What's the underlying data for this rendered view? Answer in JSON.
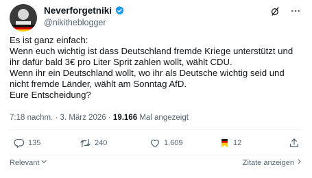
{
  "author": {
    "display_name": "Neverforgetniki",
    "handle": "@nikitheblogger",
    "verified": true
  },
  "post": {
    "lines": [
      "Es ist ganz einfach:",
      "Wenn euch wichtig ist dass Deutschland fremde Kriege unterstützt und",
      "ihr dafür bald 3€ pro Liter Sprit zahlen wollt, wählt CDU.",
      "Wenn ihr ein Deutschland wollt, wo ihr als Deutsche wichtig seid und",
      "nicht fremde Länder, wählt am Sonntag AfD.",
      "Eure Entscheidung?"
    ]
  },
  "meta": {
    "time": "7:18 nachm.",
    "separator": "·",
    "date": "3. März 2026",
    "views_count": "19.166",
    "views_label": "Mal angezeigt"
  },
  "stats": {
    "replies": "135",
    "reposts": "240",
    "likes": "1.609",
    "bookmarks": "12"
  },
  "footer": {
    "sort_label": "Relevant",
    "quotes_label": "Zitate anzeigen"
  },
  "icons": {
    "header": [
      "grok-slash-icon",
      "more-icon"
    ],
    "actions": [
      "reply-icon",
      "repost-icon",
      "like-icon",
      "bookmark-icon",
      "share-icon"
    ]
  },
  "colors": {
    "verified_badge": "#1d9bf0",
    "secondary_text": "#536471",
    "primary_text": "#0f1419"
  }
}
